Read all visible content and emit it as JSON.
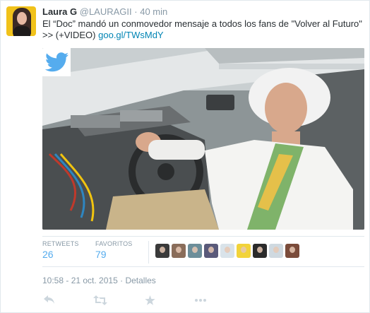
{
  "tweet": {
    "name": "Laura G",
    "handle": "@LAURAGII",
    "separator": "·",
    "time": "40 min",
    "text": "El “Doc” mandó un conmovedor mensaje a todos los fans de \"Volver al Futuro\" >> (+VIDEO)",
    "link": "goo.gl/TWsMdY"
  },
  "media": {
    "logo_icon": "twitter-bird-icon",
    "brand_color": "#55acee",
    "alt": ""
  },
  "stats": {
    "retweets_label": "RETWEETS",
    "retweets": "26",
    "favorites_label": "FAVORITOS",
    "favorites": "79",
    "favoriter_avatars": [
      "#3a3a3a",
      "#8a6d5a",
      "#6c8e9a",
      "#5a5a7a",
      "#d9e3ea",
      "#f2d33a",
      "#2b2b2b",
      "#cfd9e0",
      "#7a4b3a"
    ]
  },
  "meta": {
    "timestamp": "10:58 - 21 oct. 2015",
    "separator": "·",
    "details": "Detalles"
  },
  "actions": {
    "reply_icon": "reply-icon",
    "retweet_icon": "retweet-icon",
    "favorite_icon": "star-icon",
    "more_icon": "more-icon"
  }
}
